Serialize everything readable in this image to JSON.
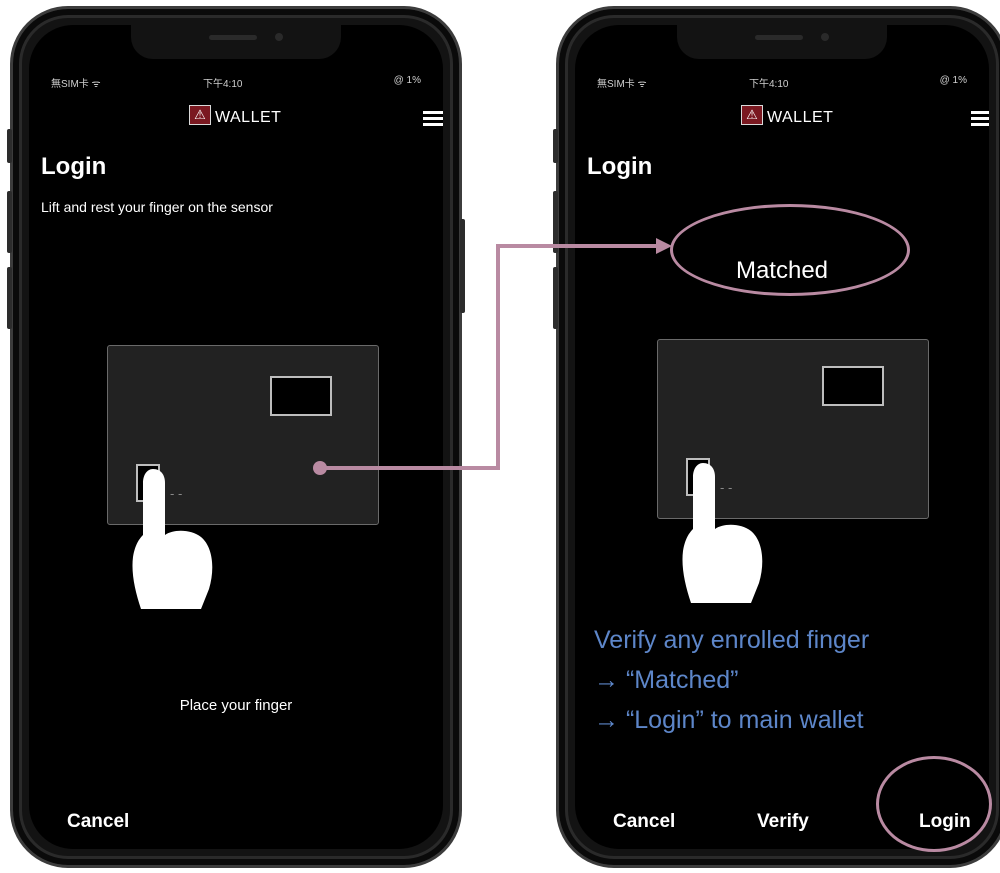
{
  "left_screen": {
    "status": {
      "carrier": "無SIM卡 ᯤ",
      "time": "下午4:10",
      "battery": "@ 1%"
    },
    "brand": {
      "logo_glyph": "⚠",
      "name": "WALLET"
    },
    "title": "Login",
    "subtitle": "Lift and rest your finger on the sensor",
    "card_dots": "- -",
    "prompt": "Place your finger",
    "cancel_label": "Cancel"
  },
  "right_screen": {
    "status": {
      "carrier": "無SIM卡 ᯤ",
      "time": "下午4:10",
      "battery": "@ 1%"
    },
    "brand": {
      "logo_glyph": "⚠",
      "name": "WALLET"
    },
    "title": "Login",
    "matched_label": "Matched",
    "card_dots": "- -",
    "cancel_label": "Cancel",
    "verify_label": "Verify",
    "login_label": "Login"
  },
  "annotation": {
    "lines": [
      "Verify any enrolled finger",
      "→ “Matched”",
      "→ “Login” to main wallet"
    ],
    "highlight_color": "#b98aa2",
    "text_color": "#5d86c9"
  }
}
